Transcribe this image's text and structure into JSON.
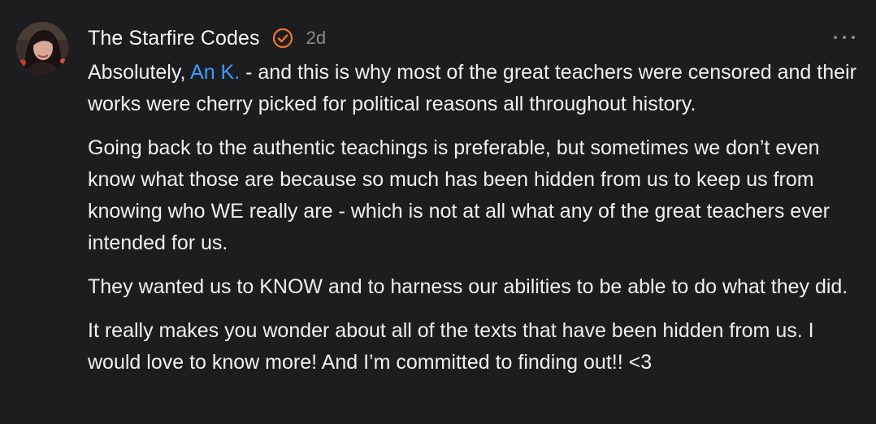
{
  "comment": {
    "author": "The Starfire Codes",
    "timestamp": "2d",
    "colors": {
      "background": "#1d1d1f",
      "text": "#f0f0f0",
      "muted": "#8a8a8e",
      "mention": "#3d9bff",
      "verified_badge": "#f0762a"
    },
    "icons": {
      "verified": "verified-check-icon",
      "more": "more-horizontal-icon"
    },
    "paragraph1": {
      "prefix": "Absolutely, ",
      "mention": "An K.",
      "suffix": " - and this is why most of the great teachers were censored and their works were cherry picked for political reasons all throughout history."
    },
    "paragraph2": "Going back to the authentic teachings is preferable, but sometimes we don’t even know what those are because so much has been hidden from us to keep us from knowing who WE really are - which is not at all what any of the great teachers ever intended for us.",
    "paragraph3": "They wanted us to KNOW and to harness our abilities to be able to do what they did.",
    "paragraph4": "It really makes you wonder about all of the texts that have been hidden from us. I would love to know more! And I’m committed to finding out!! <3"
  }
}
